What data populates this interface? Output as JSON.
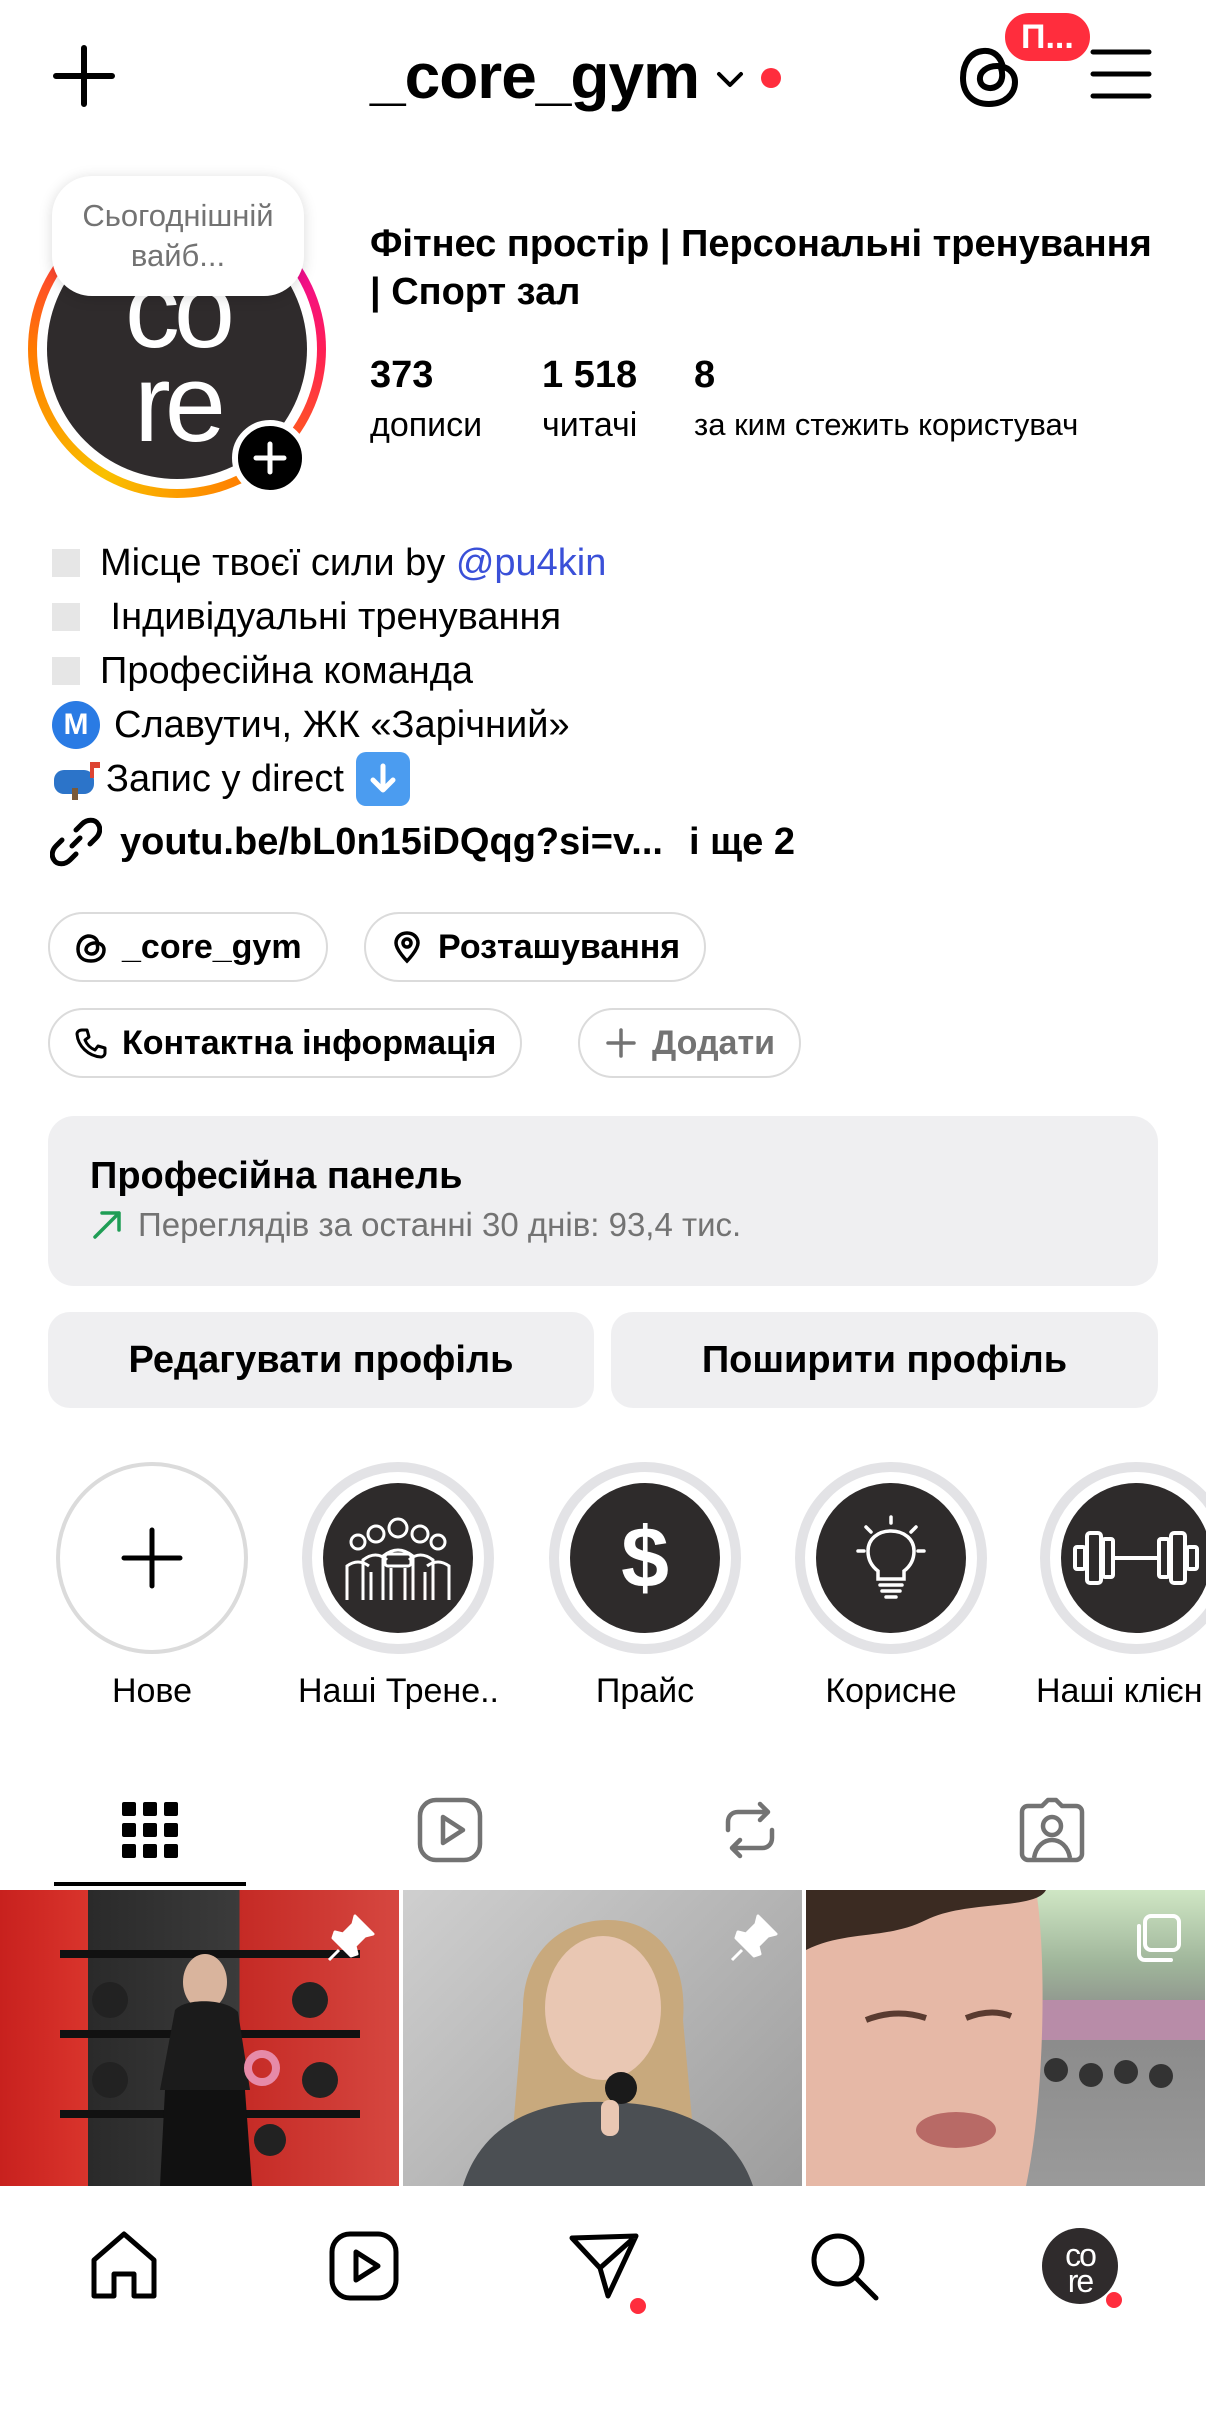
{
  "header": {
    "username": "_core_gym",
    "threads_badge": "П...",
    "new_post_icon": "plus-icon",
    "menu_icon": "hamburger-menu-icon"
  },
  "profile": {
    "note": "Сьогоднішній вайб...",
    "avatar_logo": "core",
    "full_name": "Фітнес простір | Персональні тренування | Спорт зал",
    "stats": [
      {
        "value": "373",
        "label": "дописи"
      },
      {
        "value": "1 518",
        "label": "читачі"
      },
      {
        "value": "8",
        "label": "за ким стежить користувач"
      }
    ],
    "bio": {
      "line1_text": "Місце твоєї сили by ",
      "line1_mention": "@pu4kin",
      "line2": " Індивідуальні тренування",
      "line3": "Професійна команда",
      "line4_badge": "M",
      "line4": "Славутич, ЖК «Зарічний»",
      "line5": "Запис у direct"
    },
    "link": {
      "url": "youtu.be/bL0n15iDQqg?si=v...",
      "more": "і ще 2"
    }
  },
  "chips": {
    "threads": "_core_gym",
    "location": "Розташування",
    "contact": "Контактна інформація",
    "add": "Додати"
  },
  "pro_panel": {
    "title": "Професійна панель",
    "subtitle": "Переглядів за останні 30 днів: 93,4 тис.",
    "trend_color": "#1f9d55"
  },
  "actions": {
    "edit": "Редагувати профіль",
    "share": "Поширити профіль"
  },
  "highlights": [
    {
      "label": "Нове",
      "icon": "plus-icon"
    },
    {
      "label": "Наші Трене...",
      "icon": "team-icon"
    },
    {
      "label": "Прайс",
      "icon": "dollar-icon"
    },
    {
      "label": "Корисне",
      "icon": "lightbulb-icon"
    },
    {
      "label": "Наші клієн",
      "icon": "dumbbell-icon"
    }
  ],
  "tabs": [
    "grid-icon",
    "reels-icon",
    "reposts-icon",
    "tagged-icon"
  ],
  "posts": [
    {
      "icon": "pin-icon"
    },
    {
      "icon": "pin-icon"
    },
    {
      "icon": "multi-post-icon"
    }
  ],
  "bottom_nav": [
    "home-icon",
    "reels-icon",
    "direct-icon",
    "search-icon",
    "profile-avatar"
  ],
  "colors": {
    "accent_red": "#ff2d3d",
    "mention_blue": "#3a50d8",
    "panel_bg": "#efeff1"
  }
}
